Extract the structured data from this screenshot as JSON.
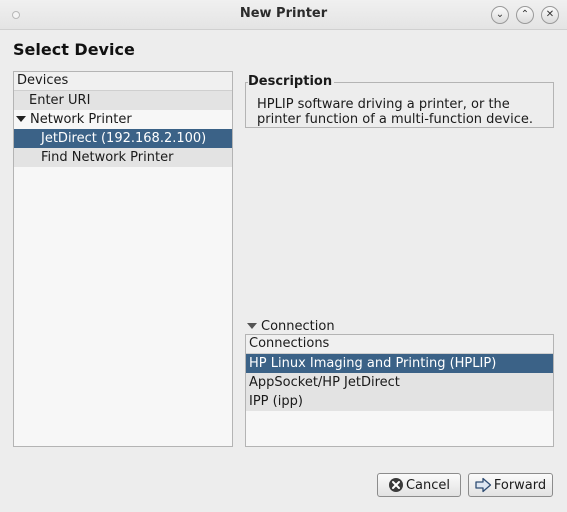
{
  "window": {
    "title": "New Printer"
  },
  "page": {
    "heading": "Select Device"
  },
  "devices": {
    "header": "Devices",
    "items": [
      {
        "label": "Enter URI"
      },
      {
        "label": "Network Printer"
      },
      {
        "label": "JetDirect (192.168.2.100)"
      },
      {
        "label": "Find Network Printer"
      }
    ]
  },
  "description": {
    "title": "Description",
    "text": "HPLIP software driving a printer, or the printer function of a multi-function device."
  },
  "connection": {
    "label": "Connection",
    "header": "Connections",
    "items": [
      {
        "label": "HP Linux Imaging and Printing (HPLIP)"
      },
      {
        "label": "AppSocket/HP JetDirect"
      },
      {
        "label": "IPP (ipp)"
      }
    ]
  },
  "buttons": {
    "cancel": "Cancel",
    "forward": "Forward"
  },
  "icons": {
    "window_menu": "circle-icon",
    "minimize": "chevron-down-icon",
    "maximize": "chevron-up-icon",
    "close": "close-icon",
    "cancel": "cancel-icon",
    "forward": "forward-arrow-icon"
  },
  "colors": {
    "selection": "#3b6287",
    "window_bg": "#ededed"
  }
}
